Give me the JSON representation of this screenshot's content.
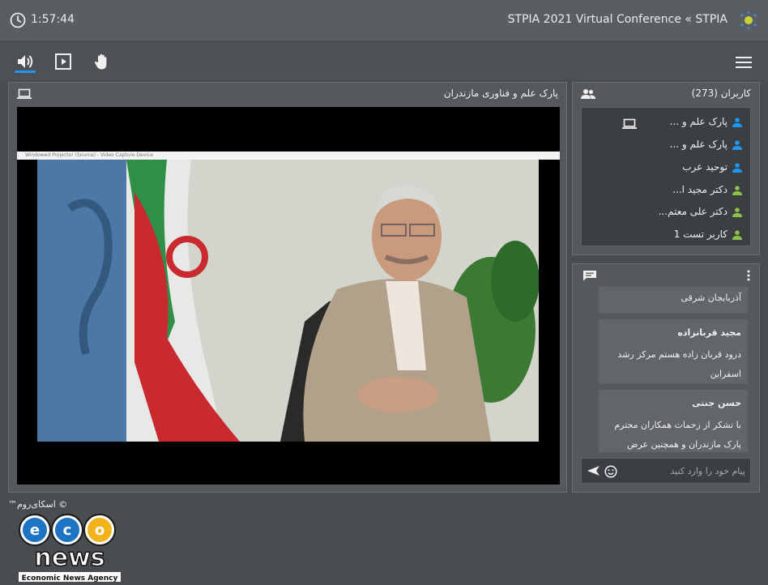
{
  "header": {
    "time": "1:57:44",
    "title": "STPIA 2021 Virtual Conference « STPIA",
    "clock_icon": "clock-icon",
    "logo_icon": "stpia-logo-icon"
  },
  "toolbar": {
    "audio_icon": "speaker-icon",
    "media_icon": "play-icon",
    "raise_hand_icon": "hand-icon",
    "menu_icon": "hamburger-menu-icon",
    "active_color": "#2196f3"
  },
  "video": {
    "presenter_name": "پارک علم و فناوری مازندران",
    "projector_caption": "Windowed Projector (Source) - Video Capture Device",
    "screen_icon": "laptop-icon"
  },
  "users": {
    "title": "کاربران (273)",
    "icon": "users-icon",
    "items": [
      {
        "name": "پارک علم و ...",
        "role_color": "#2196f3",
        "sharing": true
      },
      {
        "name": "پارک علم و ...",
        "role_color": "#2196f3",
        "sharing": false
      },
      {
        "name": "توحید عرب",
        "role_color": "#2196f3",
        "sharing": false
      },
      {
        "name": "دکتر مجید ا...",
        "role_color": "#8bc34a",
        "sharing": false
      },
      {
        "name": "دکتر علی معتم...",
        "role_color": "#8bc34a",
        "sharing": false
      },
      {
        "name": "کاربر تست 1",
        "role_color": "#8bc34a",
        "sharing": false
      }
    ]
  },
  "chat": {
    "icon": "chat-icon",
    "messages": [
      {
        "author": "",
        "text": "آذربایجان شرقی"
      },
      {
        "author": "مجید قربانزاده",
        "text": "درود   قربان زاده هستم   مرکز رشد اسفراین"
      },
      {
        "author": "حسن جنتی",
        "text": "با تشکر از زحمات همکاران محترم پارک مازندران و همچنین عرض"
      }
    ],
    "input_placeholder": "پیام خود را وارد کنید",
    "send_icon": "send-icon",
    "emoji_icon": "emoji-icon"
  },
  "watermark": {
    "brand": "eco news",
    "tagline": "Economic News Agency",
    "copyright": "© اسکای‌روم™"
  }
}
